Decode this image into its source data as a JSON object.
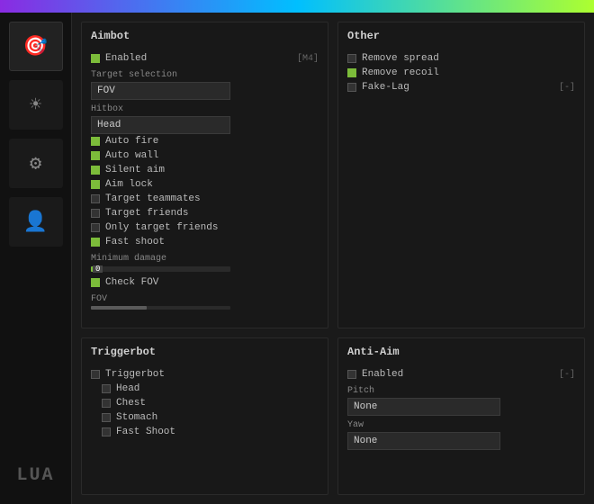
{
  "topbar": {},
  "sidebar": {
    "items": [
      {
        "id": "crosshair",
        "icon": "🎯",
        "active": true
      },
      {
        "id": "brightness",
        "icon": "☀",
        "active": false
      },
      {
        "id": "settings",
        "icon": "⚙",
        "active": false
      },
      {
        "id": "profile",
        "icon": "👤",
        "active": false
      }
    ],
    "lua_label": "LUA"
  },
  "aimbot": {
    "title": "Aimbot",
    "enabled_label": "Enabled",
    "enabled_checked": true,
    "enabled_key": "[M4]",
    "target_selection_label": "Target selection",
    "target_selection_value": "FOV",
    "hitbox_label": "Hitbox",
    "hitbox_value": "Head",
    "auto_fire_label": "Auto fire",
    "auto_fire_checked": true,
    "auto_wall_label": "Auto wall",
    "auto_wall_checked": true,
    "silent_aim_label": "Silent aim",
    "silent_aim_checked": true,
    "aim_lock_label": "Aim lock",
    "aim_lock_checked": true,
    "target_teammates_label": "Target teammates",
    "target_teammates_checked": false,
    "target_friends_label": "Target friends",
    "target_friends_checked": false,
    "only_target_friends_label": "Only target friends",
    "only_target_friends_checked": false,
    "fast_shoot_label": "Fast shoot",
    "fast_shoot_checked": true,
    "minimum_damage_label": "Minimum damage",
    "minimum_damage_value": "0",
    "check_fov_label": "Check FOV",
    "check_fov_checked": true,
    "fov_label": "FOV"
  },
  "other": {
    "title": "Other",
    "remove_spread_label": "Remove spread",
    "remove_spread_checked": false,
    "remove_recoil_label": "Remove recoil",
    "remove_recoil_checked": true,
    "fake_lag_label": "Fake-Lag",
    "fake_lag_checked": false,
    "fake_lag_key": "[-]"
  },
  "triggerbot": {
    "title": "Triggerbot",
    "triggerbot_label": "Triggerbot",
    "triggerbot_checked": false,
    "head_label": "Head",
    "head_checked": false,
    "chest_label": "Chest",
    "chest_checked": false,
    "stomach_label": "Stomach",
    "stomach_checked": false,
    "fast_shoot_label": "Fast Shoot",
    "fast_shoot_checked": false
  },
  "antiaim": {
    "title": "Anti-Aim",
    "enabled_label": "Enabled",
    "enabled_checked": false,
    "enabled_key": "[-]",
    "pitch_label": "Pitch",
    "pitch_value": "None",
    "yaw_label": "Yaw",
    "yaw_value": "None"
  }
}
